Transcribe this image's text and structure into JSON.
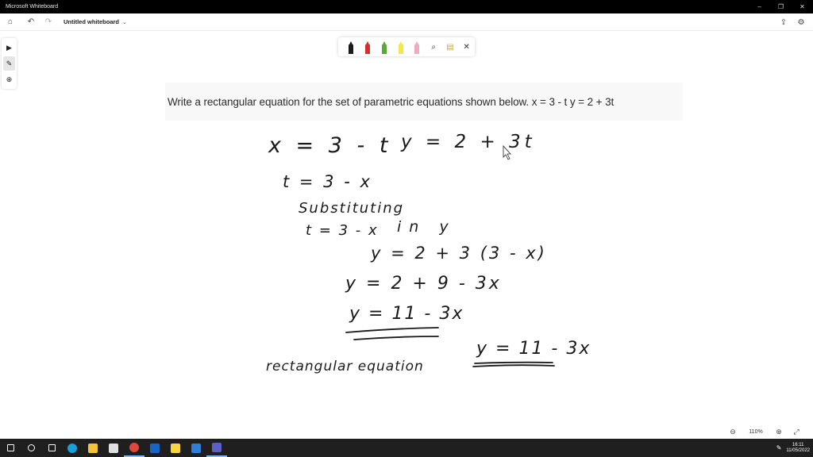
{
  "window": {
    "app_title": "Microsoft Whiteboard",
    "minimize_glyph": "–",
    "restore_glyph": "❐",
    "close_glyph": "✕"
  },
  "toolbar": {
    "home_glyph": "⌂",
    "undo_glyph": "↶",
    "redo_glyph": "↷",
    "document_name": "Untitled whiteboard",
    "doc_chevron": "⌄",
    "share_glyph": "⇪",
    "settings_glyph": "⚙"
  },
  "rail": {
    "select_glyph": "▶",
    "ink_glyph": "✎",
    "add_glyph": "⊕"
  },
  "palette": {
    "pens": [
      {
        "name": "black-pen",
        "color": "#1a1a1a"
      },
      {
        "name": "red-pen",
        "color": "#d32f2f"
      },
      {
        "name": "green-pen",
        "color": "#5aa83a"
      },
      {
        "name": "yellow-highlighter",
        "color": "#f2e84b"
      },
      {
        "name": "pink-highlighter",
        "color": "#f2a8c0"
      }
    ],
    "lasso_glyph": "⌕",
    "ruler_glyph": "▤",
    "close_glyph": "✕"
  },
  "question": {
    "text": "Write a rectangular equation for the set of parametric equations shown below. x = 3 - t y = 2 + 3t"
  },
  "handwriting": {
    "line1_left": "x = 3 - t",
    "line1_right": "y = 2 + 3t",
    "line2": "t = 3 - x",
    "line3": "Substituting",
    "line4_left": "t = 3 - x",
    "line4_right": "in y",
    "line5": "y = 2 + 3 (3 - x)",
    "line6": "y = 2 + 9 - 3x",
    "line7": "y = 11 - 3x",
    "line8_label": "rectangular equation",
    "line8_answer": "y = 11 - 3x",
    "ink_color": "#1a1a1a"
  },
  "zoom": {
    "zoom_out_glyph": "⊖",
    "value": "110%",
    "zoom_in_glyph": "⊕",
    "fit_glyph": "⤢"
  },
  "taskbar": {
    "apps": [
      {
        "name": "windows-start-icon",
        "color": "#ffffff"
      },
      {
        "name": "search-icon",
        "color": "#ffffff"
      },
      {
        "name": "task-view-icon",
        "color": "#ffffff"
      },
      {
        "name": "edge-icon",
        "color": "#1aa0d8"
      },
      {
        "name": "file-explorer-icon",
        "color": "#f3c43b"
      },
      {
        "name": "store-icon",
        "color": "#e0e0e0"
      },
      {
        "name": "chrome-icon",
        "color": "#e2453c"
      },
      {
        "name": "outlook-icon",
        "color": "#1667c5"
      },
      {
        "name": "sticky-notes-icon",
        "color": "#f6d444"
      },
      {
        "name": "mail-icon",
        "color": "#2f7fd9"
      },
      {
        "name": "teams-icon",
        "color": "#5b5fc7"
      }
    ],
    "time": "16:11",
    "date": "11/05/2022"
  }
}
